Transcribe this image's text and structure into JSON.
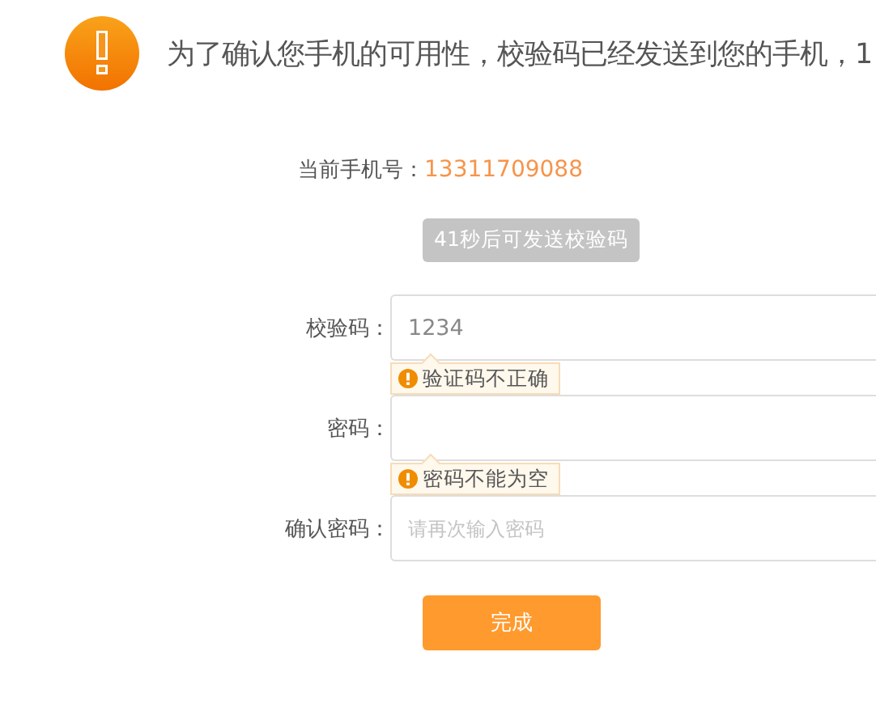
{
  "notice": {
    "text": "为了确认您手机的可用性，校验码已经发送到您的手机，1"
  },
  "phone": {
    "label": "当前手机号：",
    "value": "13311709088"
  },
  "resend_button": {
    "label": "41秒后可发送校验码",
    "disabled": true
  },
  "fields": [
    {
      "label": "校验码：",
      "value": "1234",
      "error": "验证码不正确"
    },
    {
      "label": "密码：",
      "error": "密码不能为空"
    },
    {
      "label": "确认密码：",
      "placeholder": "请再次输入密码"
    }
  ],
  "submit_button": {
    "label": "完成"
  }
}
